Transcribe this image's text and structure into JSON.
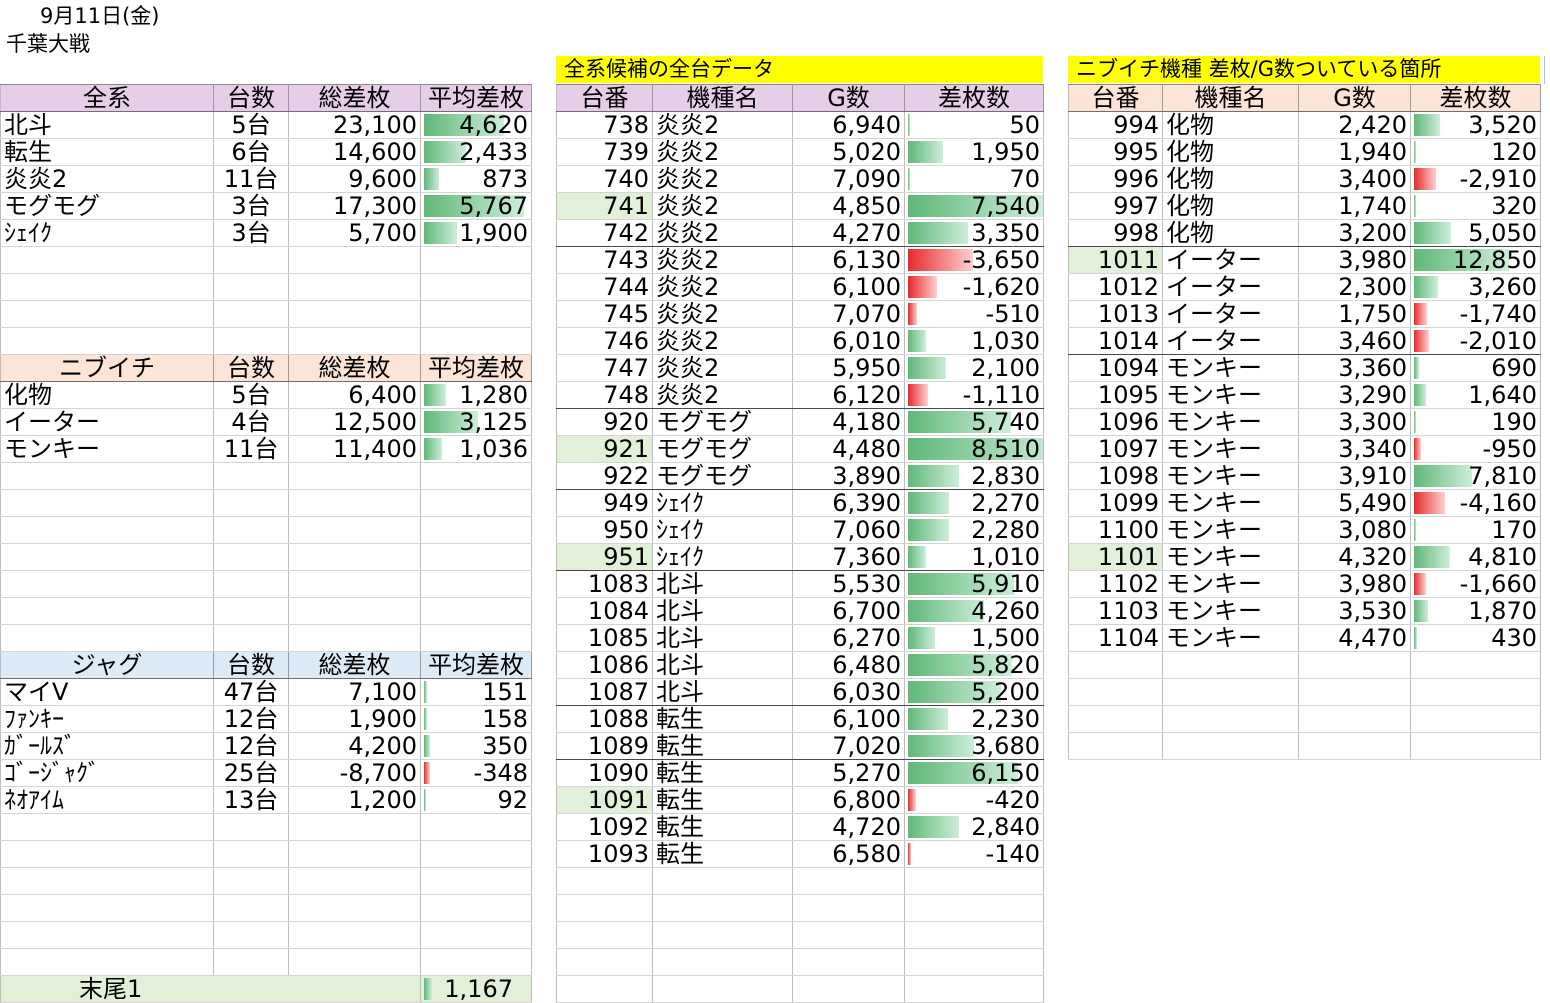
{
  "header": {
    "date": "9月11日(金)",
    "store": "千葉大戦"
  },
  "colors": {
    "all_header": "#e8cde8",
    "nibu_header": "#fce4d6",
    "jug_header": "#ddebf7",
    "title_bg": "#ffff00",
    "highlight": "#e2f0d9",
    "bar_positive": "#63be7b",
    "bar_negative": "#f8696b"
  },
  "all": {
    "headers": [
      "全系",
      "台数",
      "総差枚",
      "平均差枚"
    ],
    "rows": [
      {
        "name": "北斗",
        "count": "5台",
        "total": "23,100",
        "avg": "4,620",
        "avg_num": 4620
      },
      {
        "name": "転生",
        "count": "6台",
        "total": "14,600",
        "avg": "2,433",
        "avg_num": 2433
      },
      {
        "name": "炎炎2",
        "count": "11台",
        "total": "9,600",
        "avg": "873",
        "avg_num": 873
      },
      {
        "name": "モグモグ",
        "count": "3台",
        "total": "17,300",
        "avg": "5,767",
        "avg_num": 5767
      },
      {
        "name": "ｼｪｲｸ",
        "count": "3台",
        "total": "5,700",
        "avg": "1,900",
        "avg_num": 1900
      }
    ]
  },
  "nibu": {
    "headers": [
      "ニブイチ",
      "台数",
      "総差枚",
      "平均差枚"
    ],
    "rows": [
      {
        "name": "化物",
        "count": "5台",
        "total": "6,400",
        "avg": "1,280",
        "avg_num": 1280
      },
      {
        "name": "イーター",
        "count": "4台",
        "total": "12,500",
        "avg": "3,125",
        "avg_num": 3125
      },
      {
        "name": "モンキー",
        "count": "11台",
        "total": "11,400",
        "avg": "1,036",
        "avg_num": 1036
      }
    ]
  },
  "jug": {
    "headers": [
      "ジャグ",
      "台数",
      "総差枚",
      "平均差枚"
    ],
    "rows": [
      {
        "name": "マイV",
        "count": "47台",
        "total": "7,100",
        "avg": "151",
        "avg_num": 151
      },
      {
        "name": "ﾌｧﾝｷｰ",
        "count": "12台",
        "total": "1,900",
        "avg": "158",
        "avg_num": 158
      },
      {
        "name": "ｶﾞｰﾙｽﾞ",
        "count": "12台",
        "total": "4,200",
        "avg": "350",
        "avg_num": 350
      },
      {
        "name": "ｺﾞｰｼﾞｬｸﾞ",
        "count": "25台",
        "total": "-8,700",
        "avg": "-348",
        "avg_num": -348
      },
      {
        "name": "ﾈｵｱｲﾑ",
        "count": "13台",
        "total": "1,200",
        "avg": "92",
        "avg_num": 92
      }
    ]
  },
  "suffix": {
    "label": "末尾1",
    "value": "1,167",
    "value_num": 1167
  },
  "middle": {
    "title": "全系候補の全台データ",
    "headers": [
      "台番",
      "機種名",
      "G数",
      "差枚数"
    ],
    "rows": [
      {
        "no": "738",
        "model": "炎炎2",
        "g": "6,940",
        "diff": "50",
        "diff_num": 50
      },
      {
        "no": "739",
        "model": "炎炎2",
        "g": "5,020",
        "diff": "1,950",
        "diff_num": 1950
      },
      {
        "no": "740",
        "model": "炎炎2",
        "g": "7,090",
        "diff": "70",
        "diff_num": 70
      },
      {
        "no": "741",
        "model": "炎炎2",
        "g": "4,850",
        "diff": "7,540",
        "diff_num": 7540,
        "hl": true
      },
      {
        "no": "742",
        "model": "炎炎2",
        "g": "4,270",
        "diff": "3,350",
        "diff_num": 3350
      },
      {
        "no": "743",
        "model": "炎炎2",
        "g": "6,130",
        "diff": "-3,650",
        "diff_num": -3650
      },
      {
        "no": "744",
        "model": "炎炎2",
        "g": "6,100",
        "diff": "-1,620",
        "diff_num": -1620
      },
      {
        "no": "745",
        "model": "炎炎2",
        "g": "7,070",
        "diff": "-510",
        "diff_num": -510
      },
      {
        "no": "746",
        "model": "炎炎2",
        "g": "6,010",
        "diff": "1,030",
        "diff_num": 1030
      },
      {
        "no": "747",
        "model": "炎炎2",
        "g": "5,950",
        "diff": "2,100",
        "diff_num": 2100
      },
      {
        "no": "748",
        "model": "炎炎2",
        "g": "6,120",
        "diff": "-1,110",
        "diff_num": -1110
      },
      {
        "no": "920",
        "model": "モグモグ",
        "g": "4,180",
        "diff": "5,740",
        "diff_num": 5740
      },
      {
        "no": "921",
        "model": "モグモグ",
        "g": "4,480",
        "diff": "8,510",
        "diff_num": 8510,
        "hl": true
      },
      {
        "no": "922",
        "model": "モグモグ",
        "g": "3,890",
        "diff": "2,830",
        "diff_num": 2830
      },
      {
        "no": "949",
        "model": "ｼｪｲｸ",
        "g": "6,390",
        "diff": "2,270",
        "diff_num": 2270
      },
      {
        "no": "950",
        "model": "ｼｪｲｸ",
        "g": "7,060",
        "diff": "2,280",
        "diff_num": 2280
      },
      {
        "no": "951",
        "model": "ｼｪｲｸ",
        "g": "7,360",
        "diff": "1,010",
        "diff_num": 1010,
        "hl": true
      },
      {
        "no": "1083",
        "model": "北斗",
        "g": "5,530",
        "diff": "5,910",
        "diff_num": 5910
      },
      {
        "no": "1084",
        "model": "北斗",
        "g": "6,700",
        "diff": "4,260",
        "diff_num": 4260
      },
      {
        "no": "1085",
        "model": "北斗",
        "g": "6,270",
        "diff": "1,500",
        "diff_num": 1500
      },
      {
        "no": "1086",
        "model": "北斗",
        "g": "6,480",
        "diff": "5,820",
        "diff_num": 5820
      },
      {
        "no": "1087",
        "model": "北斗",
        "g": "6,030",
        "diff": "5,200",
        "diff_num": 5200
      },
      {
        "no": "1088",
        "model": "転生",
        "g": "6,100",
        "diff": "2,230",
        "diff_num": 2230
      },
      {
        "no": "1089",
        "model": "転生",
        "g": "7,020",
        "diff": "3,680",
        "diff_num": 3680
      },
      {
        "no": "1090",
        "model": "転生",
        "g": "5,270",
        "diff": "6,150",
        "diff_num": 6150
      },
      {
        "no": "1091",
        "model": "転生",
        "g": "6,800",
        "diff": "-420",
        "diff_num": -420,
        "hl": true
      },
      {
        "no": "1092",
        "model": "転生",
        "g": "4,720",
        "diff": "2,840",
        "diff_num": 2840
      },
      {
        "no": "1093",
        "model": "転生",
        "g": "6,580",
        "diff": "-140",
        "diff_num": -140
      }
    ]
  },
  "right": {
    "title": "ニブイチ機種 差枚/G数ついている箇所",
    "headers": [
      "台番",
      "機種名",
      "G数",
      "差枚数"
    ],
    "rows": [
      {
        "no": "994",
        "model": "化物",
        "g": "2,420",
        "diff": "3,520",
        "diff_num": 3520
      },
      {
        "no": "995",
        "model": "化物",
        "g": "1,940",
        "diff": "120",
        "diff_num": 120
      },
      {
        "no": "996",
        "model": "化物",
        "g": "3,400",
        "diff": "-2,910",
        "diff_num": -2910
      },
      {
        "no": "997",
        "model": "化物",
        "g": "1,740",
        "diff": "320",
        "diff_num": 320
      },
      {
        "no": "998",
        "model": "化物",
        "g": "3,200",
        "diff": "5,050",
        "diff_num": 5050
      },
      {
        "no": "1011",
        "model": "イーター",
        "g": "3,980",
        "diff": "12,850",
        "diff_num": 12850,
        "hl": true
      },
      {
        "no": "1012",
        "model": "イーター",
        "g": "2,300",
        "diff": "3,260",
        "diff_num": 3260
      },
      {
        "no": "1013",
        "model": "イーター",
        "g": "1,750",
        "diff": "-1,740",
        "diff_num": -1740
      },
      {
        "no": "1014",
        "model": "イーター",
        "g": "3,460",
        "diff": "-2,010",
        "diff_num": -2010
      },
      {
        "no": "1094",
        "model": "モンキー",
        "g": "3,360",
        "diff": "690",
        "diff_num": 690
      },
      {
        "no": "1095",
        "model": "モンキー",
        "g": "3,290",
        "diff": "1,640",
        "diff_num": 1640
      },
      {
        "no": "1096",
        "model": "モンキー",
        "g": "3,300",
        "diff": "190",
        "diff_num": 190
      },
      {
        "no": "1097",
        "model": "モンキー",
        "g": "3,340",
        "diff": "-950",
        "diff_num": -950
      },
      {
        "no": "1098",
        "model": "モンキー",
        "g": "3,910",
        "diff": "7,810",
        "diff_num": 7810
      },
      {
        "no": "1099",
        "model": "モンキー",
        "g": "5,490",
        "diff": "-4,160",
        "diff_num": -4160
      },
      {
        "no": "1100",
        "model": "モンキー",
        "g": "3,080",
        "diff": "170",
        "diff_num": 170
      },
      {
        "no": "1101",
        "model": "モンキー",
        "g": "4,320",
        "diff": "4,810",
        "diff_num": 4810,
        "hl": true
      },
      {
        "no": "1102",
        "model": "モンキー",
        "g": "3,980",
        "diff": "-1,660",
        "diff_num": -1660
      },
      {
        "no": "1103",
        "model": "モンキー",
        "g": "3,530",
        "diff": "1,870",
        "diff_num": 1870
      },
      {
        "no": "1104",
        "model": "モンキー",
        "g": "4,470",
        "diff": "430",
        "diff_num": 430
      }
    ]
  }
}
